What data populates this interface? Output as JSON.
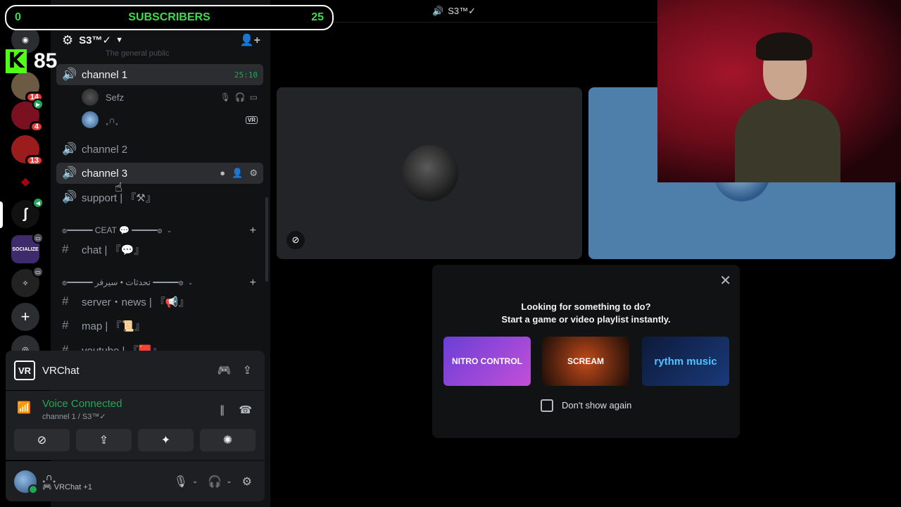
{
  "overlay": {
    "subs_left": "0",
    "subs_label": "SUBSCRIBERS",
    "subs_right": "25",
    "kick_count": "85"
  },
  "rail": {
    "badges": [
      "14",
      "4",
      "13"
    ],
    "servers": [
      {
        "name": "SOCIALIZE"
      }
    ]
  },
  "server": {
    "name": "S3™✓"
  },
  "hint": "The general public",
  "channels": {
    "channel1": {
      "name": "channel 1",
      "timer": "25:10"
    },
    "channel2": {
      "name": "channel 2"
    },
    "channel3": {
      "name": "channel 3"
    },
    "support": {
      "name": "support |  『⚒』"
    }
  },
  "members": [
    {
      "name": "Sefz"
    },
    {
      "name": "˳∩˳",
      "tag": "VR"
    }
  ],
  "categories": {
    "ceat": "๏━━━━━ CEAT 💬 ━━━━━๏",
    "arabic": "๏━━━━━ تحدثات • سيرفر ━━━━━๏"
  },
  "text_channels": [
    {
      "name": "chat |  『💬』"
    },
    {
      "name": "server・news |  『📢』"
    },
    {
      "name": "map |  『📜』"
    },
    {
      "name": "youtube |  『🟥』"
    }
  ],
  "activity": {
    "logo": "VR",
    "name": "VRChat"
  },
  "voice": {
    "status": "Voice Connected",
    "where": "channel 1 / S3™✓"
  },
  "user": {
    "name": "˳∩˳",
    "status": "VRChat +1"
  },
  "topbar": {
    "title": "S3™✓"
  },
  "popup": {
    "line1": "Looking for something to do?",
    "line2": "Start a game or video playlist instantly.",
    "cards": [
      "NITRO CONTROL",
      "SCREAM",
      "rythm music"
    ],
    "checkbox_label": "Don't show again"
  }
}
